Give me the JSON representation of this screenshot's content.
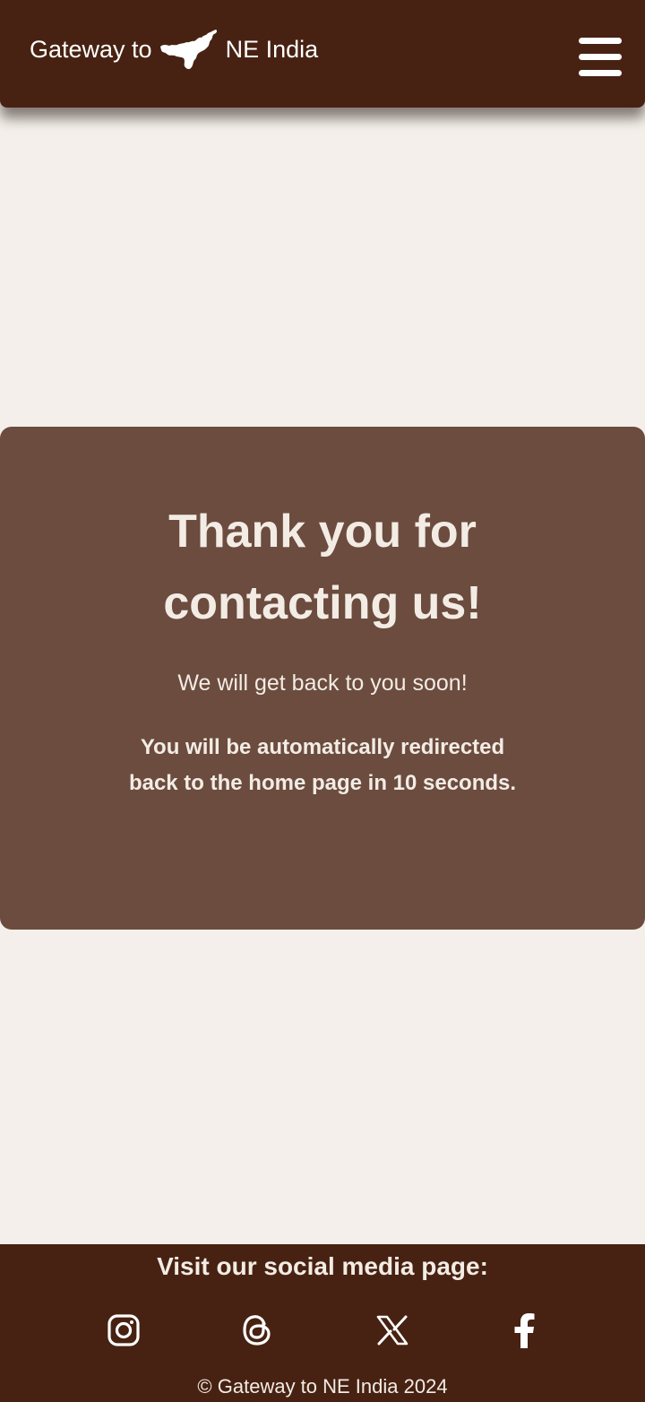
{
  "header": {
    "brand_prefix": "Gateway to",
    "brand_suffix": "NE India",
    "map_icon": "northeast-india-map-icon",
    "menu_icon": "hamburger-menu-icon"
  },
  "message": {
    "title": "Thank you for contacting us!",
    "subtitle": "We will get back to you soon!",
    "redirect_note": "You will be automatically redirected back to the home page in 10 seconds."
  },
  "footer": {
    "heading": "Visit our social media page:",
    "social_icons": [
      "instagram-icon",
      "threads-icon",
      "x-icon",
      "facebook-icon"
    ],
    "copyright": "© Gateway to NE India 2024"
  },
  "colors": {
    "header_bg": "#472212",
    "page_bg": "#f4efea",
    "card_bg": "#6b4c3e",
    "text_light": "#f3ece5"
  }
}
